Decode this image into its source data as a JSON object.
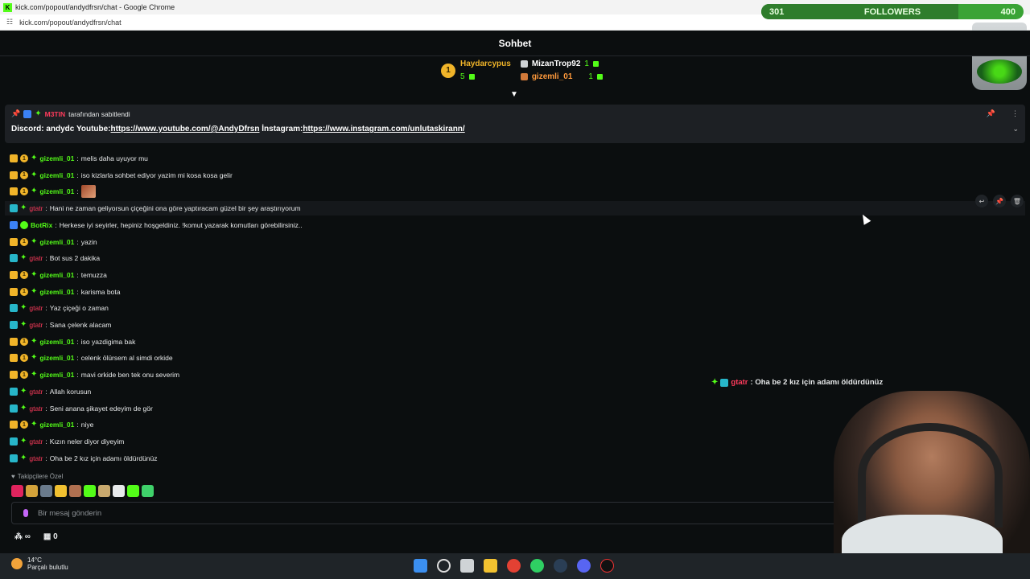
{
  "window": {
    "title": "kick.com/popout/andydfrsn/chat - Google Chrome",
    "url": "kick.com/popout/andydfrsn/chat"
  },
  "header": {
    "title": "Sohbet"
  },
  "leaderboard": {
    "first": {
      "rank": "1",
      "name": "Haydarcypus",
      "gifts": "5"
    },
    "second": {
      "name": "MizanTrop92",
      "gifts": "1"
    },
    "third": {
      "name": "gizemli_01",
      "gifts": "1"
    }
  },
  "pinned": {
    "by_user": "M3TIN",
    "by_suffix": "tarafından sabitlendi",
    "text_prefix": "Discord: andydc Youtube:",
    "youtube_link": "https://www.youtube.com/@AndyDfrsn",
    "text_mid": " İnstagram:",
    "instagram_link": "https://www.instagram.com/unlutaskirann/"
  },
  "messages": [
    {
      "type": "vip",
      "user": "gizemli_01",
      "text": "melis daha uyuyor mu"
    },
    {
      "type": "vip",
      "user": "gizemli_01",
      "text": "iso kizlarla sohbet ediyor yazim mi kosa kosa gelir"
    },
    {
      "type": "vip-emote",
      "user": "gizemli_01",
      "text": ""
    },
    {
      "type": "mod",
      "user": "gtatr",
      "text": "Hani ne zaman geliyorsun çiçeğini ona göre yaptıracam güzel bir şey araştırıyorum"
    },
    {
      "type": "bot",
      "user": "BotRix",
      "text": "Herkese iyi seyirler, hepiniz hoşgeldiniz. !komut yazarak komutları görebilirsiniz.."
    },
    {
      "type": "vip",
      "user": "gizemli_01",
      "text": "yazin"
    },
    {
      "type": "mod",
      "user": "gtatr",
      "text": "Bot sus 2 dakika"
    },
    {
      "type": "vip",
      "user": "gizemli_01",
      "text": "temuzza"
    },
    {
      "type": "vip",
      "user": "gizemli_01",
      "text": "karisma bota"
    },
    {
      "type": "mod",
      "user": "gtatr",
      "text": "Yaz çiçeği o zaman"
    },
    {
      "type": "mod",
      "user": "gtatr",
      "text": "Sana çelenk alacam"
    },
    {
      "type": "vip",
      "user": "gizemli_01",
      "text": "iso yazdigima bak"
    },
    {
      "type": "vip",
      "user": "gizemli_01",
      "text": "celenk ölürsem al simdi orkide"
    },
    {
      "type": "vip",
      "user": "gizemli_01",
      "text": "mavi orkide ben tek onu severim"
    },
    {
      "type": "mod",
      "user": "gtatr",
      "text": "Allah korusun"
    },
    {
      "type": "mod",
      "user": "gtatr",
      "text": "Seni anana şikayet edeyim de gör"
    },
    {
      "type": "vip",
      "user": "gizemli_01",
      "text": "niye"
    },
    {
      "type": "mod",
      "user": "gtatr",
      "text": "Kızın neler diyor diyeyim"
    },
    {
      "type": "mod",
      "user": "gtatr",
      "text": "Oha be 2 kız için adamı öldürdünüz"
    }
  ],
  "overlay": {
    "user": "gtatr",
    "text": ": Oha be 2 kız için adamı öldürdünüz"
  },
  "followers_goal": {
    "current": "301",
    "label": "FOLLOWERS",
    "target": "400",
    "progress": 0.75
  },
  "chat_footer": {
    "followers_only": "Takipçilere Özel",
    "input_placeholder": "Bir mesaj gönderin",
    "infinity": "∞",
    "gift_count": "0"
  },
  "taskbar": {
    "temp": "14°C",
    "condition": "Parçalı bulutlu",
    "badge": "2"
  },
  "colors": {
    "kick_green": "#53fc18",
    "mod_red": "#ff3b5c",
    "gold": "#f0b429"
  }
}
